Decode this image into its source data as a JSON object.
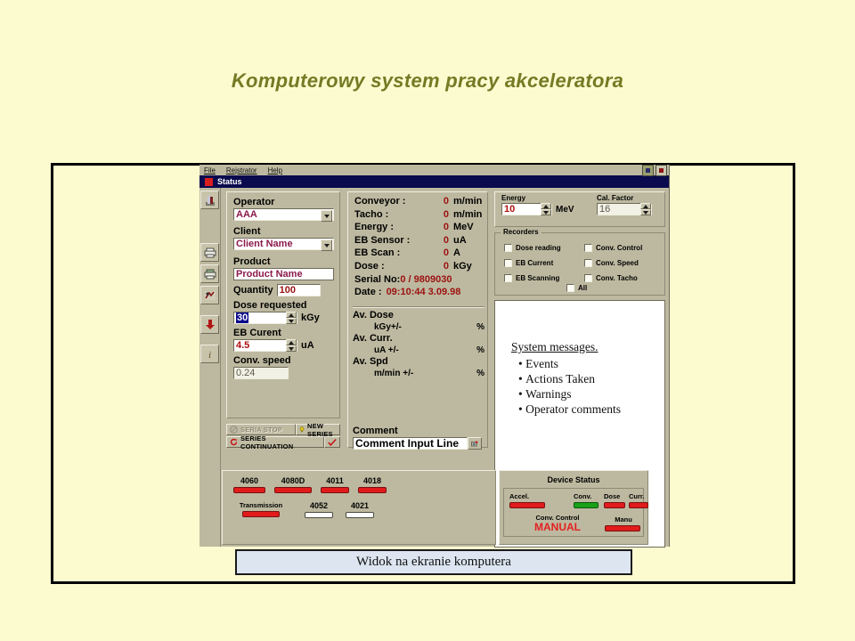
{
  "slide": {
    "title": "Komputerowy system pracy akceleratora",
    "caption": "Widok na ekranie komputera"
  },
  "window": {
    "menu": [
      "File",
      "Rejstrator",
      "Help"
    ],
    "title": "Status",
    "minimize_icon": "minimize-icon",
    "restore_icon": "restore-icon"
  },
  "toolbar": {
    "items": [
      {
        "name": "building-icon",
        "glyph": "█"
      },
      {
        "name": "printer-icon",
        "glyph": "⎙"
      },
      {
        "name": "print-preview-icon",
        "glyph": "⎙"
      },
      {
        "name": "tools-icon",
        "glyph": "⚒"
      },
      {
        "name": "down-arrow-icon",
        "glyph": "↓"
      },
      {
        "name": "info-icon",
        "glyph": "ℹ"
      }
    ]
  },
  "left_panel": {
    "operator": {
      "label": "Operator",
      "value": "AAA"
    },
    "client": {
      "label": "Client",
      "value": "Client Name"
    },
    "product": {
      "label": "Product",
      "value": "Product Name"
    },
    "quantity": {
      "label": "Quantity",
      "value": "100"
    },
    "dose_requested": {
      "label": "Dose requested",
      "value": "30",
      "unit": "kGy"
    },
    "eb_current": {
      "label": "EB Curent",
      "value": "4.5",
      "unit": "uA"
    },
    "conv_speed": {
      "label": "Conv. speed",
      "value": "0.24"
    },
    "buttons": {
      "series_stop": "SERIA STOP",
      "new_series": "NEW SERIES",
      "series_continuation": "SERIES CONTINUATION",
      "confirm_icon": "check-icon",
      "stop_icon": "stop-icon",
      "bulb_icon": "bulb-icon",
      "refresh_icon": "refresh-icon"
    }
  },
  "readouts": [
    {
      "name": "Conveyor :",
      "value": "0",
      "unit": "m/min"
    },
    {
      "name": "Tacho :",
      "value": "0",
      "unit": "m/min"
    },
    {
      "name": "Energy :",
      "value": "0",
      "unit": "MeV"
    },
    {
      "name": "EB Sensor :",
      "value": "0",
      "unit": "uA"
    },
    {
      "name": "EB Scan :",
      "value": "0",
      "unit": "A"
    },
    {
      "name": "Dose :",
      "value": "0",
      "unit": "kGy"
    }
  ],
  "serial": {
    "label": "Serial No:",
    "value": "0 / 9809030"
  },
  "date": {
    "label": "Date :",
    "value": "09:10:44 3.09.98"
  },
  "averages": [
    {
      "label": "Av. Dose",
      "unit": "kGy+/-",
      "pct": "%"
    },
    {
      "label": "Av. Curr.",
      "unit": "uA  +/-",
      "pct": "%"
    },
    {
      "label": "Av. Spd",
      "unit": "m/min +/-",
      "pct": "%"
    }
  ],
  "comment": {
    "label": "Comment",
    "value": "Comment Input Line",
    "icon": "camera-icon"
  },
  "energy_group": {
    "energy": {
      "label": "Energy",
      "value": "10",
      "unit": "MeV"
    },
    "cal_factor": {
      "label": "Cal. Factor",
      "value": "16"
    }
  },
  "recorders": {
    "legend": "Recorders",
    "items": [
      "Dose reading",
      "Conv. Control",
      "EB Current",
      "Conv. Speed",
      "EB Scanning",
      "Conv. Tacho"
    ],
    "all": "All"
  },
  "messages": {
    "heading": "System messages.",
    "items": [
      "Events",
      "Actions Taken",
      "Warnings",
      "Operator comments"
    ]
  },
  "bottom": {
    "device_numbers": [
      "4060",
      "4080D",
      "4011",
      "4018"
    ],
    "transmission_label": "Transmission",
    "transmission_numbers": [
      "4052",
      "4021"
    ],
    "device_status_title": "Device  Status",
    "status_items": [
      "Accel.",
      "Conv.",
      "Dose",
      "Curr."
    ],
    "conv_control_label": "Conv. Control",
    "conv_control_value": "MANUAL",
    "manu_label": "Manu"
  },
  "colors": {
    "page_bg": "#FCFBD0",
    "title": "#757A24",
    "window_face": "#BDB9A0",
    "titlebar": "#0A0A4E",
    "value_red": "#9C1111",
    "led_red": "#E11B1B",
    "led_green": "#18A018",
    "manual_red": "#E32020",
    "field_text": "#8B1A4A"
  }
}
